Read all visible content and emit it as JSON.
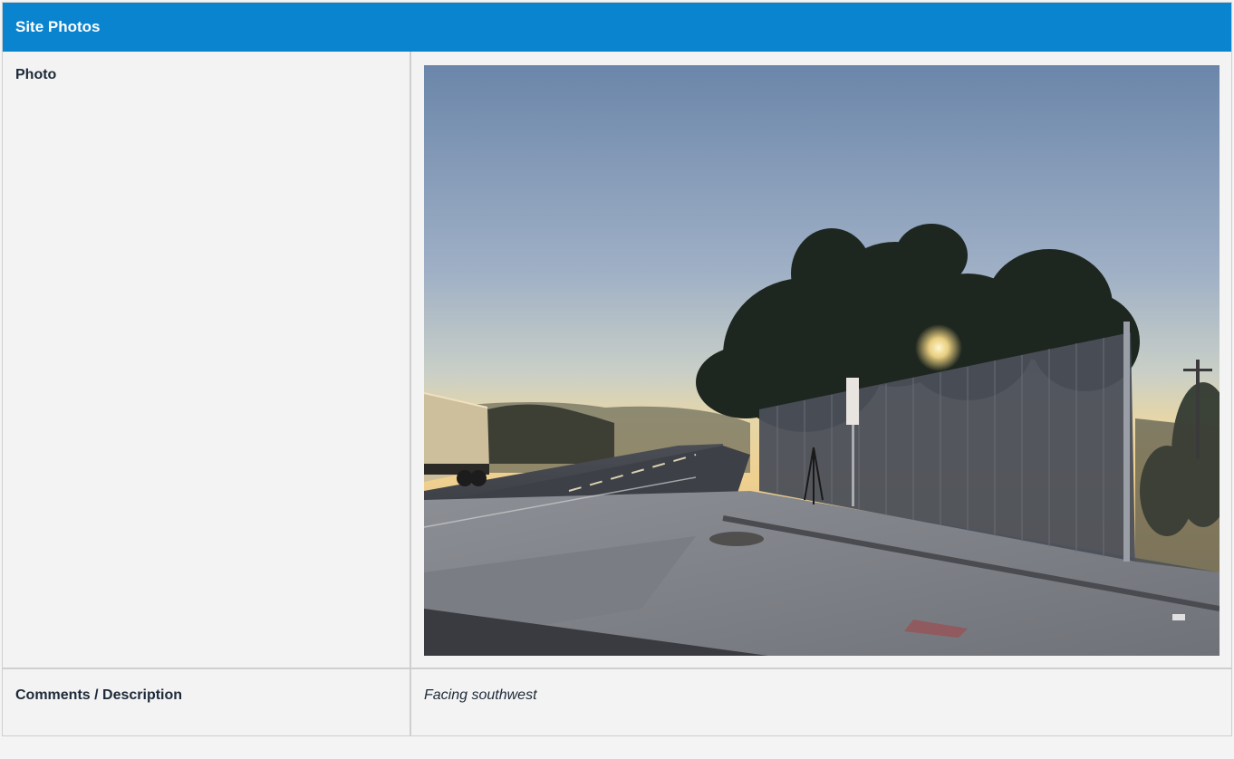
{
  "header": {
    "title": "Site Photos"
  },
  "photo_row": {
    "label": "Photo",
    "image_icon": "site-photo-image"
  },
  "comments_row": {
    "label": "Comments / Description",
    "value": "Facing southwest"
  },
  "colors": {
    "header_bg": "#0a84cf",
    "panel_bg": "#f3f3f3",
    "border": "#cfcfcf"
  }
}
